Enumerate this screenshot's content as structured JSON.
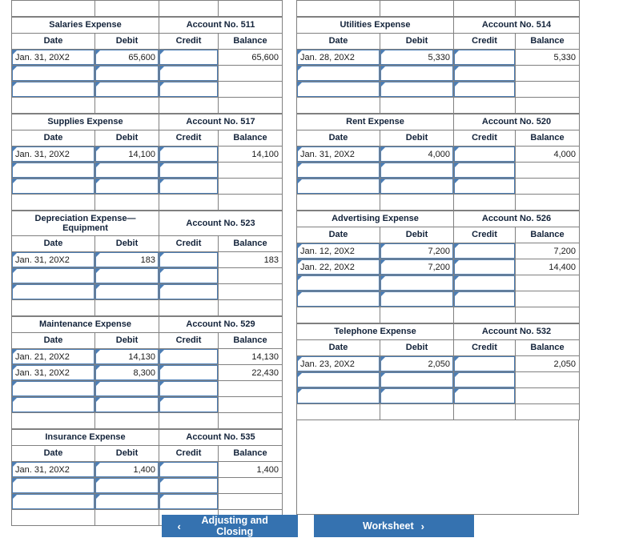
{
  "ledger": {
    "column_headers": [
      "Date",
      "Debit",
      "Credit",
      "Balance"
    ],
    "left_accounts": [
      {
        "title": "Salaries Expense",
        "account_no": "Account No. 511",
        "rows": [
          {
            "date": "Jan. 31, 20X2",
            "debit": "65,600",
            "credit": "",
            "balance": "65,600"
          },
          {
            "date": "",
            "debit": "",
            "credit": "",
            "balance": ""
          },
          {
            "date": "",
            "debit": "",
            "credit": "",
            "balance": ""
          }
        ],
        "filled_rows": 1
      },
      {
        "title": "Supplies Expense",
        "account_no": "Account No. 517",
        "rows": [
          {
            "date": "Jan. 31, 20X2",
            "debit": "14,100",
            "credit": "",
            "balance": "14,100"
          },
          {
            "date": "",
            "debit": "",
            "credit": "",
            "balance": ""
          },
          {
            "date": "",
            "debit": "",
            "credit": "",
            "balance": ""
          }
        ],
        "filled_rows": 1
      },
      {
        "title": "Depreciation Expense—Equipment",
        "account_no": "Account No. 523",
        "rows": [
          {
            "date": "Jan. 31, 20X2",
            "debit": "183",
            "credit": "",
            "balance": "183"
          },
          {
            "date": "",
            "debit": "",
            "credit": "",
            "balance": ""
          },
          {
            "date": "",
            "debit": "",
            "credit": "",
            "balance": ""
          }
        ],
        "filled_rows": 1
      },
      {
        "title": "Maintenance Expense",
        "account_no": "Account No. 529",
        "rows": [
          {
            "date": "Jan. 21, 20X2",
            "debit": "14,130",
            "credit": "",
            "balance": "14,130"
          },
          {
            "date": "Jan. 31, 20X2",
            "debit": "8,300",
            "credit": "",
            "balance": "22,430"
          },
          {
            "date": "",
            "debit": "",
            "credit": "",
            "balance": ""
          },
          {
            "date": "",
            "debit": "",
            "credit": "",
            "balance": ""
          }
        ],
        "filled_rows": 2
      },
      {
        "title": "Insurance Expense",
        "account_no": "Account No. 535",
        "rows": [
          {
            "date": "Jan. 31, 20X2",
            "debit": "1,400",
            "credit": "",
            "balance": "1,400"
          },
          {
            "date": "",
            "debit": "",
            "credit": "",
            "balance": ""
          },
          {
            "date": "",
            "debit": "",
            "credit": "",
            "balance": ""
          }
        ],
        "filled_rows": 1
      }
    ],
    "right_accounts": [
      {
        "title": "Utilities Expense",
        "account_no": "Account No. 514",
        "rows": [
          {
            "date": "Jan. 28, 20X2",
            "debit": "5,330",
            "credit": "",
            "balance": "5,330"
          },
          {
            "date": "",
            "debit": "",
            "credit": "",
            "balance": ""
          },
          {
            "date": "",
            "debit": "",
            "credit": "",
            "balance": ""
          }
        ],
        "filled_rows": 1
      },
      {
        "title": "Rent Expense",
        "account_no": "Account No. 520",
        "rows": [
          {
            "date": "Jan. 31, 20X2",
            "debit": "4,000",
            "credit": "",
            "balance": "4,000"
          },
          {
            "date": "",
            "debit": "",
            "credit": "",
            "balance": ""
          },
          {
            "date": "",
            "debit": "",
            "credit": "",
            "balance": ""
          }
        ],
        "filled_rows": 1
      },
      {
        "title": "Advertising Expense",
        "account_no": "Account No. 526",
        "rows": [
          {
            "date": "Jan. 12, 20X2",
            "debit": "7,200",
            "credit": "",
            "balance": "7,200"
          },
          {
            "date": "Jan. 22, 20X2",
            "debit": "7,200",
            "credit": "",
            "balance": "14,400"
          },
          {
            "date": "",
            "debit": "",
            "credit": "",
            "balance": ""
          },
          {
            "date": "",
            "debit": "",
            "credit": "",
            "balance": ""
          }
        ],
        "filled_rows": 2
      },
      {
        "title": "Telephone Expense",
        "account_no": "Account No. 532",
        "rows": [
          {
            "date": "Jan. 23, 20X2",
            "debit": "2,050",
            "credit": "",
            "balance": "2,050"
          },
          {
            "date": "",
            "debit": "",
            "credit": "",
            "balance": ""
          },
          {
            "date": "",
            "debit": "",
            "credit": "",
            "balance": ""
          }
        ],
        "filled_rows": 1
      }
    ]
  },
  "footer": {
    "prev_label": "Adjusting and Closing",
    "prev_icon": "chevron-left-icon",
    "prev_chevron": "‹",
    "next_label": "Worksheet",
    "next_icon": "chevron-right-icon",
    "next_chevron": "›"
  },
  "colors": {
    "header_blue": "#6fa8dc",
    "button_blue": "#3572b0",
    "input_border": "#4d7eb4",
    "grid_line": "#808080"
  }
}
